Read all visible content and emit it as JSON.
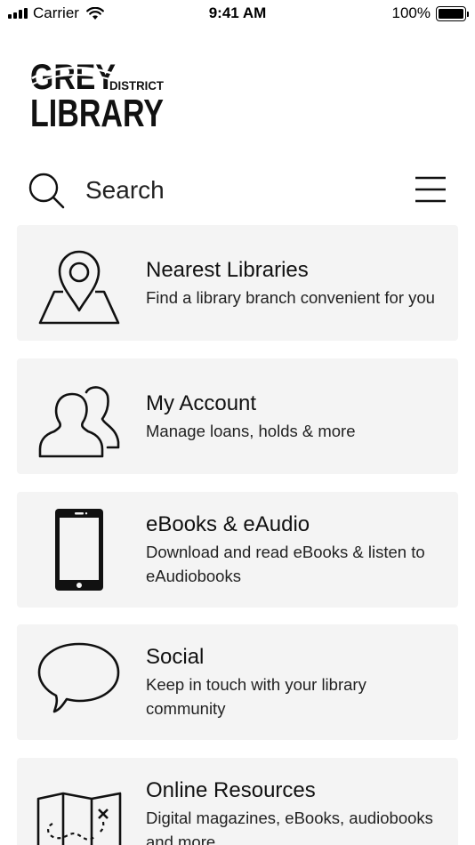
{
  "status_bar": {
    "carrier": "Carrier",
    "time": "9:41 AM",
    "battery_percent": "100%",
    "signal_bars": 4,
    "battery_level": 1.0
  },
  "logo": {
    "line1": "GREY",
    "line2": "DISTRICT",
    "line3": "LIBRARY"
  },
  "search": {
    "label": "Search",
    "icon": "search-icon"
  },
  "menu": {
    "icon": "hamburger-menu-icon"
  },
  "cards": [
    {
      "title": "Nearest Libraries",
      "description": "Find a library branch convenient for you",
      "icon": "map-pin-icon"
    },
    {
      "title": "My Account",
      "description": "Manage loans, holds & more",
      "icon": "users-icon"
    },
    {
      "title": "eBooks & eAudio",
      "description": "Download and read eBooks & listen to eAudiobooks",
      "icon": "smartphone-icon"
    },
    {
      "title": "Social",
      "description": "Keep in touch with your library community",
      "icon": "speech-bubble-icon"
    },
    {
      "title": "Online Resources",
      "description": "Digital magazines, eBooks, audiobooks and more",
      "icon": "treasure-map-icon"
    }
  ],
  "colors": {
    "card_background": "#f4f4f4",
    "text": "#111111",
    "background": "#ffffff"
  }
}
